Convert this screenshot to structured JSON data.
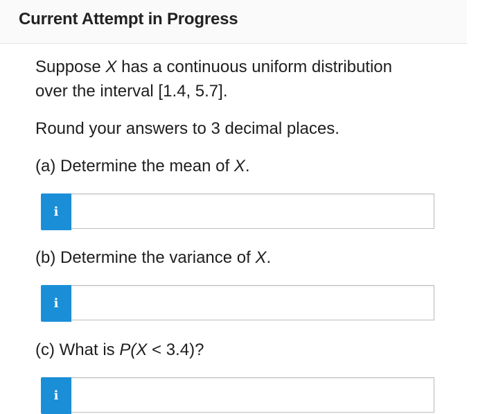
{
  "header": {
    "title": "Current Attempt in Progress"
  },
  "question": {
    "intro_part1": "Suppose ",
    "intro_var": "X",
    "intro_part2": " has a continuous uniform distribution",
    "intro_line2": "over the interval [1.4, 5.7].",
    "rounding": "Round your answers to 3 decimal places.",
    "parts": [
      {
        "label_pre": "(a) Determine the mean of ",
        "label_var": "X",
        "label_post": ".",
        "info_icon": "i",
        "value": ""
      },
      {
        "label_pre": "(b) Determine the variance of ",
        "label_var": "X",
        "label_post": ".",
        "info_icon": "i",
        "value": ""
      },
      {
        "label_pre": "(c) What is ",
        "label_var": "P(X",
        "label_post": " < 3.4)?",
        "info_icon": "i",
        "value": ""
      }
    ]
  },
  "colors": {
    "info_button": "#1a8fd8",
    "header_bg": "#fafafa"
  },
  "icons": {
    "info": "info-icon"
  }
}
